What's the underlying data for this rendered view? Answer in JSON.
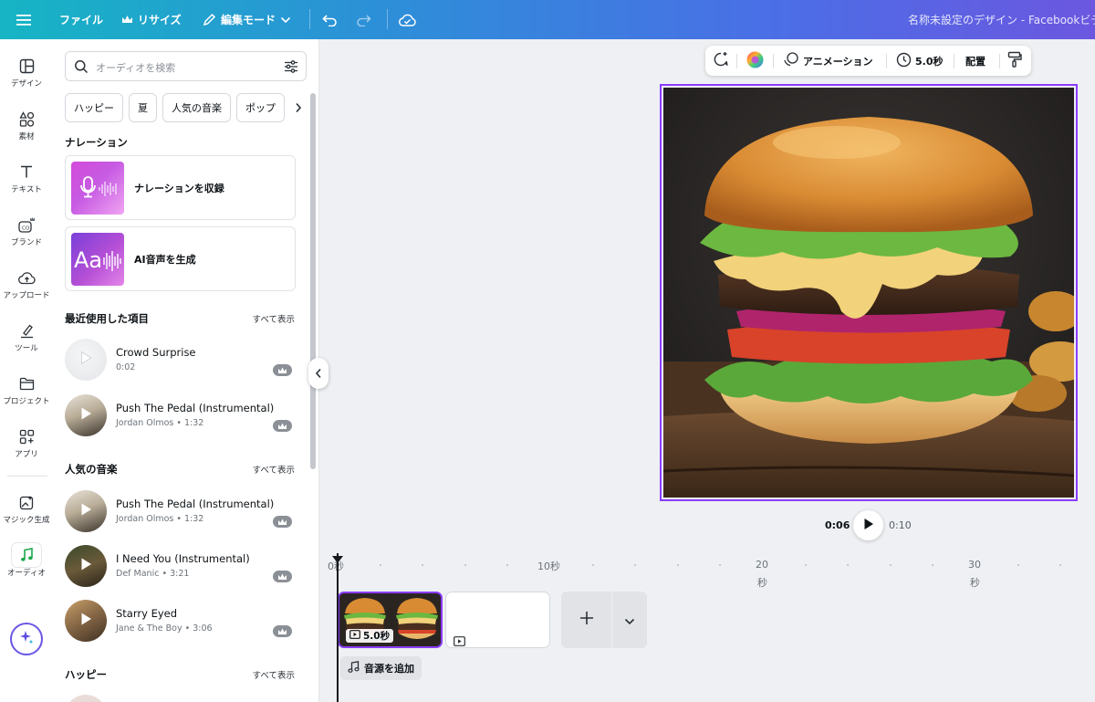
{
  "topbar": {
    "file": "ファイル",
    "resize": "リサイズ",
    "edit_mode": "編集モード",
    "title": "名称未設定のデザイン - Facebookビデ"
  },
  "rail": {
    "design": "デザイン",
    "elements": "素材",
    "text": "テキスト",
    "brand": "ブランド",
    "upload": "アップロード",
    "tools": "ツール",
    "projects": "プロジェクト",
    "apps": "アプリ",
    "magic": "マジック生成",
    "audio": "オーディオ"
  },
  "panel": {
    "search_placeholder": "オーディオを検索",
    "chips": [
      "ハッピー",
      "夏",
      "人気の音楽",
      "ポップ"
    ],
    "narration_title": "ナレーション",
    "record_label": "ナレーションを収録",
    "ai_voice_label": "AI音声を生成",
    "recent_title": "最近使用した項目",
    "popular_title": "人気の音楽",
    "happy_title": "ハッピー",
    "see_all": "すべて表示",
    "recent": [
      {
        "name": "Crowd Surprise",
        "sub": "0:02"
      },
      {
        "name": "Push The Pedal (Instrumental)",
        "sub": "Jordan Olmos • 1:32"
      }
    ],
    "popular": [
      {
        "name": "Push The Pedal (Instrumental)",
        "sub": "Jordan Olmos • 1:32"
      },
      {
        "name": "I Need You (Instrumental)",
        "sub": "Def Manic • 3:21"
      },
      {
        "name": "Starry Eyed",
        "sub": "Jane & The Boy • 3:06"
      }
    ]
  },
  "toolbar": {
    "animation": "アニメーション",
    "duration": "5.0秒",
    "position": "配置"
  },
  "playback": {
    "current": "0:06",
    "total": "0:10"
  },
  "timeline": {
    "ticks": [
      "0秒",
      "10秒"
    ],
    "tick20a": "20",
    "tick20b": "秒",
    "tick30a": "30",
    "tick30b": "秒",
    "clip_duration": "5.0秒",
    "add_audio": "音源を追加"
  },
  "colors": {
    "accent": "#8b3dff",
    "topbar_start": "#16b5c4",
    "topbar_end": "#6b57e0"
  }
}
